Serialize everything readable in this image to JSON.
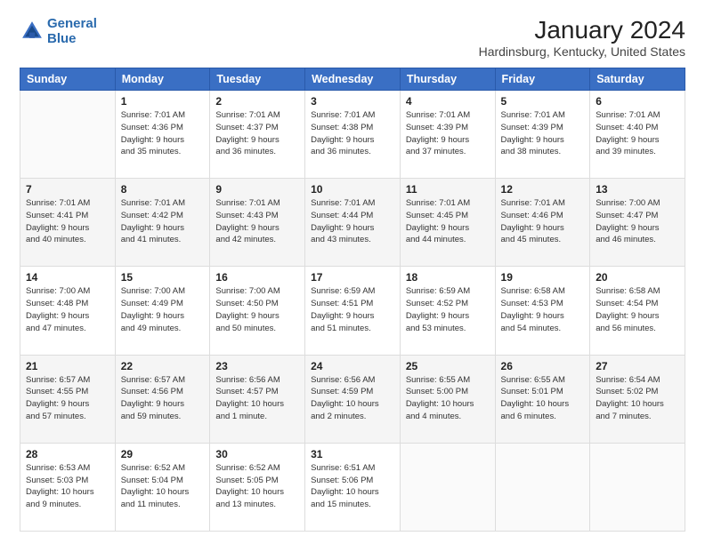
{
  "header": {
    "logo_line1": "General",
    "logo_line2": "Blue",
    "month": "January 2024",
    "location": "Hardinsburg, Kentucky, United States"
  },
  "weekdays": [
    "Sunday",
    "Monday",
    "Tuesday",
    "Wednesday",
    "Thursday",
    "Friday",
    "Saturday"
  ],
  "weeks": [
    [
      {
        "day": "",
        "info": ""
      },
      {
        "day": "1",
        "info": "Sunrise: 7:01 AM\nSunset: 4:36 PM\nDaylight: 9 hours\nand 35 minutes."
      },
      {
        "day": "2",
        "info": "Sunrise: 7:01 AM\nSunset: 4:37 PM\nDaylight: 9 hours\nand 36 minutes."
      },
      {
        "day": "3",
        "info": "Sunrise: 7:01 AM\nSunset: 4:38 PM\nDaylight: 9 hours\nand 36 minutes."
      },
      {
        "day": "4",
        "info": "Sunrise: 7:01 AM\nSunset: 4:39 PM\nDaylight: 9 hours\nand 37 minutes."
      },
      {
        "day": "5",
        "info": "Sunrise: 7:01 AM\nSunset: 4:39 PM\nDaylight: 9 hours\nand 38 minutes."
      },
      {
        "day": "6",
        "info": "Sunrise: 7:01 AM\nSunset: 4:40 PM\nDaylight: 9 hours\nand 39 minutes."
      }
    ],
    [
      {
        "day": "7",
        "info": "Sunrise: 7:01 AM\nSunset: 4:41 PM\nDaylight: 9 hours\nand 40 minutes."
      },
      {
        "day": "8",
        "info": "Sunrise: 7:01 AM\nSunset: 4:42 PM\nDaylight: 9 hours\nand 41 minutes."
      },
      {
        "day": "9",
        "info": "Sunrise: 7:01 AM\nSunset: 4:43 PM\nDaylight: 9 hours\nand 42 minutes."
      },
      {
        "day": "10",
        "info": "Sunrise: 7:01 AM\nSunset: 4:44 PM\nDaylight: 9 hours\nand 43 minutes."
      },
      {
        "day": "11",
        "info": "Sunrise: 7:01 AM\nSunset: 4:45 PM\nDaylight: 9 hours\nand 44 minutes."
      },
      {
        "day": "12",
        "info": "Sunrise: 7:01 AM\nSunset: 4:46 PM\nDaylight: 9 hours\nand 45 minutes."
      },
      {
        "day": "13",
        "info": "Sunrise: 7:00 AM\nSunset: 4:47 PM\nDaylight: 9 hours\nand 46 minutes."
      }
    ],
    [
      {
        "day": "14",
        "info": "Sunrise: 7:00 AM\nSunset: 4:48 PM\nDaylight: 9 hours\nand 47 minutes."
      },
      {
        "day": "15",
        "info": "Sunrise: 7:00 AM\nSunset: 4:49 PM\nDaylight: 9 hours\nand 49 minutes."
      },
      {
        "day": "16",
        "info": "Sunrise: 7:00 AM\nSunset: 4:50 PM\nDaylight: 9 hours\nand 50 minutes."
      },
      {
        "day": "17",
        "info": "Sunrise: 6:59 AM\nSunset: 4:51 PM\nDaylight: 9 hours\nand 51 minutes."
      },
      {
        "day": "18",
        "info": "Sunrise: 6:59 AM\nSunset: 4:52 PM\nDaylight: 9 hours\nand 53 minutes."
      },
      {
        "day": "19",
        "info": "Sunrise: 6:58 AM\nSunset: 4:53 PM\nDaylight: 9 hours\nand 54 minutes."
      },
      {
        "day": "20",
        "info": "Sunrise: 6:58 AM\nSunset: 4:54 PM\nDaylight: 9 hours\nand 56 minutes."
      }
    ],
    [
      {
        "day": "21",
        "info": "Sunrise: 6:57 AM\nSunset: 4:55 PM\nDaylight: 9 hours\nand 57 minutes."
      },
      {
        "day": "22",
        "info": "Sunrise: 6:57 AM\nSunset: 4:56 PM\nDaylight: 9 hours\nand 59 minutes."
      },
      {
        "day": "23",
        "info": "Sunrise: 6:56 AM\nSunset: 4:57 PM\nDaylight: 10 hours\nand 1 minute."
      },
      {
        "day": "24",
        "info": "Sunrise: 6:56 AM\nSunset: 4:59 PM\nDaylight: 10 hours\nand 2 minutes."
      },
      {
        "day": "25",
        "info": "Sunrise: 6:55 AM\nSunset: 5:00 PM\nDaylight: 10 hours\nand 4 minutes."
      },
      {
        "day": "26",
        "info": "Sunrise: 6:55 AM\nSunset: 5:01 PM\nDaylight: 10 hours\nand 6 minutes."
      },
      {
        "day": "27",
        "info": "Sunrise: 6:54 AM\nSunset: 5:02 PM\nDaylight: 10 hours\nand 7 minutes."
      }
    ],
    [
      {
        "day": "28",
        "info": "Sunrise: 6:53 AM\nSunset: 5:03 PM\nDaylight: 10 hours\nand 9 minutes."
      },
      {
        "day": "29",
        "info": "Sunrise: 6:52 AM\nSunset: 5:04 PM\nDaylight: 10 hours\nand 11 minutes."
      },
      {
        "day": "30",
        "info": "Sunrise: 6:52 AM\nSunset: 5:05 PM\nDaylight: 10 hours\nand 13 minutes."
      },
      {
        "day": "31",
        "info": "Sunrise: 6:51 AM\nSunset: 5:06 PM\nDaylight: 10 hours\nand 15 minutes."
      },
      {
        "day": "",
        "info": ""
      },
      {
        "day": "",
        "info": ""
      },
      {
        "day": "",
        "info": ""
      }
    ]
  ]
}
